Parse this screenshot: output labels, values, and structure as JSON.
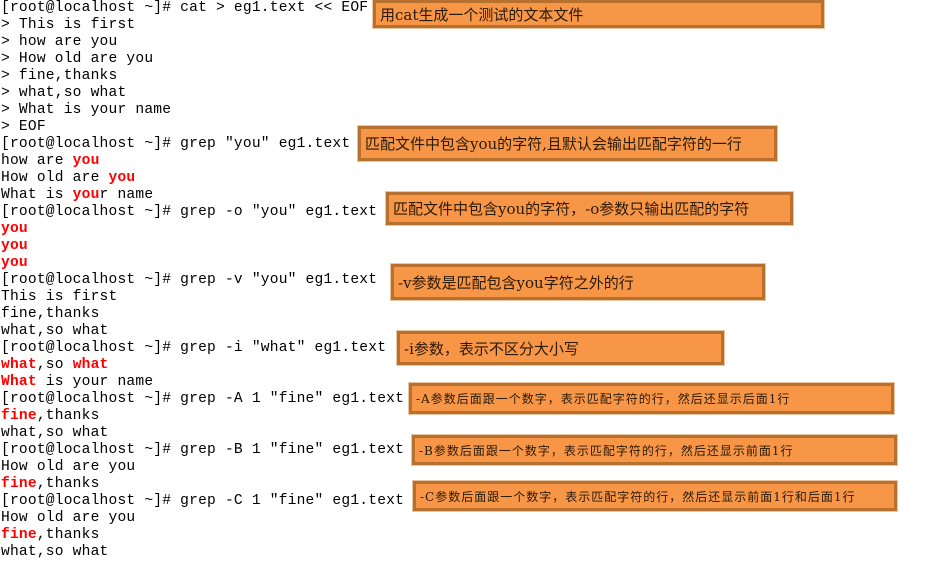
{
  "terminal": {
    "lines": [
      [
        {
          "t": "[root@localhost ~]# cat > eg1.text << EOF"
        }
      ],
      [
        {
          "t": "> This is first"
        }
      ],
      [
        {
          "t": "> how are you"
        }
      ],
      [
        {
          "t": "> How old are you"
        }
      ],
      [
        {
          "t": "> fine,thanks"
        }
      ],
      [
        {
          "t": "> what,so what"
        }
      ],
      [
        {
          "t": "> What is your name"
        }
      ],
      [
        {
          "t": "> EOF"
        }
      ],
      [
        {
          "t": "[root@localhost ~]# grep \"you\" eg1.text"
        }
      ],
      [
        {
          "t": "how are "
        },
        {
          "t": "you",
          "hl": true
        }
      ],
      [
        {
          "t": "How old are "
        },
        {
          "t": "you",
          "hl": true
        }
      ],
      [
        {
          "t": "What is "
        },
        {
          "t": "you",
          "hl": true
        },
        {
          "t": "r name"
        }
      ],
      [
        {
          "t": "[root@localhost ~]# grep -o \"you\" eg1.text"
        }
      ],
      [
        {
          "t": "you",
          "hl": true
        }
      ],
      [
        {
          "t": "you",
          "hl": true
        }
      ],
      [
        {
          "t": "you",
          "hl": true
        }
      ],
      [
        {
          "t": "[root@localhost ~]# grep -v \"you\" eg1.text"
        }
      ],
      [
        {
          "t": "This is first"
        }
      ],
      [
        {
          "t": "fine,thanks"
        }
      ],
      [
        {
          "t": "what,so what"
        }
      ],
      [
        {
          "t": "[root@localhost ~]# grep -i \"what\" eg1.text"
        }
      ],
      [
        {
          "t": "what",
          "hl": true
        },
        {
          "t": ",so "
        },
        {
          "t": "what",
          "hl": true
        }
      ],
      [
        {
          "t": "What",
          "hl": true
        },
        {
          "t": " is your name"
        }
      ],
      [
        {
          "t": "[root@localhost ~]# grep -A 1 \"fine\" eg1.text"
        }
      ],
      [
        {
          "t": "fine",
          "hl": true
        },
        {
          "t": ",thanks"
        }
      ],
      [
        {
          "t": "what,so what"
        }
      ],
      [
        {
          "t": "[root@localhost ~]# grep -B 1 \"fine\" eg1.text"
        }
      ],
      [
        {
          "t": "How old are you"
        }
      ],
      [
        {
          "t": "fine",
          "hl": true
        },
        {
          "t": ",thanks"
        }
      ],
      [
        {
          "t": "[root@localhost ~]# grep -C 1 \"fine\" eg1.text"
        }
      ],
      [
        {
          "t": "How old are you"
        }
      ],
      [
        {
          "t": "fine",
          "hl": true
        },
        {
          "t": ",thanks"
        }
      ],
      [
        {
          "t": "what,so what"
        }
      ]
    ]
  },
  "annotations": [
    {
      "id": "cat",
      "text": "用cat生成一个测试的文本文件"
    },
    {
      "id": "grep-default",
      "text": "匹配文件中包含you的字符,且默认会输出匹配字符的一行"
    },
    {
      "id": "grep-o",
      "text": "匹配文件中包含you的字符，-o参数只输出匹配的字符"
    },
    {
      "id": "grep-v",
      "text": "-v参数是匹配包含you字符之外的行"
    },
    {
      "id": "grep-i",
      "text": "-i参数，表示不区分大小写"
    },
    {
      "id": "grep-A",
      "text": "-A参数后面跟一个数字，表示匹配字符的行，然后还显示后面1行"
    },
    {
      "id": "grep-B",
      "text": "-B参数后面跟一个数字，表示匹配字符的行，然后还显示前面1行"
    },
    {
      "id": "grep-C",
      "text": "-C参数后面跟一个数字，表示匹配字符的行，然后还显示前面1行和后面1行"
    }
  ],
  "colors": {
    "highlight": "#ff0000",
    "annotation_fill": "#f79646",
    "annotation_border": "#b8702e"
  }
}
